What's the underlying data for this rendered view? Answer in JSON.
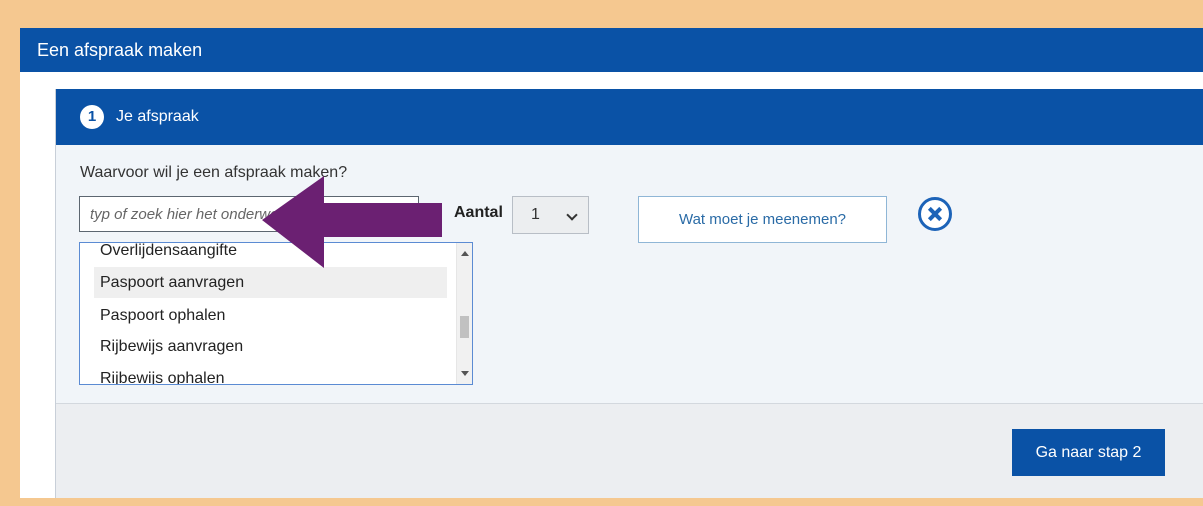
{
  "window": {
    "title": "Een afspraak maken"
  },
  "step": {
    "number": "1",
    "title": "Je afspraak"
  },
  "form": {
    "question": "Waarvoor wil je een afspraak maken?",
    "topic_placeholder": "typ of zoek hier het onderwerp voor je afspraak",
    "aantal_label": "Aantal",
    "aantal_value": "1",
    "meenemen_label": "Wat moet je meenemen?"
  },
  "listbox": {
    "items": [
      {
        "label": "Overlijdensaangifte"
      },
      {
        "label": "Paspoort aanvragen",
        "highlighted": true
      },
      {
        "label": "Paspoort ophalen"
      },
      {
        "label": "Rijbewijs aanvragen"
      },
      {
        "label": "Rijbewijs ophalen"
      }
    ]
  },
  "footer": {
    "next_label": "Ga naar stap 2"
  },
  "colors": {
    "primary": "#0a52a6",
    "annotation_arrow": "#6b2072",
    "page_border": "#f5c890"
  }
}
